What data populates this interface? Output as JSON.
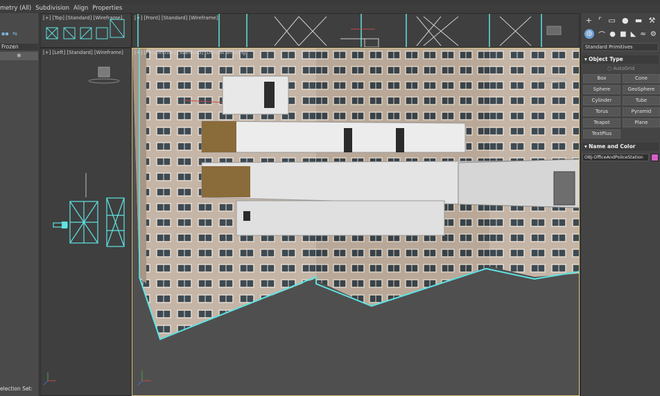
{
  "menubar": {
    "items": [
      "metry (All)",
      "Subdivision",
      "Align",
      "Properties"
    ]
  },
  "scene_explorer": {
    "frozen_label": "Frozen",
    "frozen_value": "❄",
    "selection_set_label": "election Set:"
  },
  "viewports": {
    "top_label": "[+] [Top] [Standard] [Wireframe]",
    "front_label": "[+] [Front] [Standard] [Wireframe]",
    "left_label": "[+] [Left] [Standard] [Wireframe]",
    "persp_label": "[+] [Perspective] [Standard] [Default Shading]"
  },
  "command_panel": {
    "tab_icons": [
      "plus-icon",
      "modify-icon",
      "hierarchy-icon",
      "motion-icon",
      "display-icon",
      "utilities-icon"
    ],
    "sub_icons": [
      "geometry-icon",
      "shapes-icon",
      "lights-icon",
      "cameras-icon",
      "helpers-icon",
      "spacewarps-icon",
      "systems-icon"
    ],
    "dropdown_value": "Standard Primitives",
    "object_type_title": "Object Type",
    "autogrid_label": "AutoGrid",
    "primitives": [
      "Box",
      "Cone",
      "Sphere",
      "GeoSphere",
      "Cylinder",
      "Tube",
      "Torus",
      "Pyramid",
      "Teapot",
      "Plane",
      "TextPlus"
    ],
    "name_color_title": "Name and Color",
    "object_name": "OBJ-OfficeAndPoliceStation",
    "object_color": "#d45fc8"
  },
  "colors": {
    "selection_cyan": "#5fe3e3",
    "viewport_active_border": "#d9c27a",
    "accent_blue": "#6fa3d8"
  }
}
